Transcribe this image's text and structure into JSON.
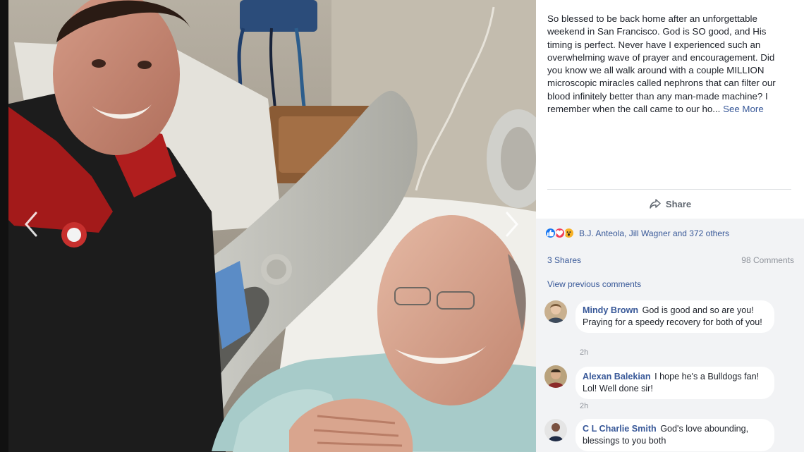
{
  "post": {
    "caption": "So blessed to be back home after an unforgettable weekend in San Francisco. God is SO good, and His timing is perfect. Never have I experienced such an overwhelming wave of prayer and encouragement. Did you know we all walk around with a couple MILLION microscopic miracles called nephrons that can filter our blood infinitely better than any man-made machine? I remember when the call came to our ho...",
    "see_more_label": "See More",
    "share_label": "Share"
  },
  "reactions": {
    "icons": [
      "like-icon",
      "love-icon",
      "wow-icon"
    ],
    "text": "B.J. Anteola, Jill Wagner and 372 others",
    "colors": {
      "like": "#1877f2",
      "love": "#f33e58",
      "wow": "#f7b125"
    }
  },
  "stats": {
    "shares": "3 Shares",
    "comments": "98 Comments",
    "view_previous": "View previous comments"
  },
  "comments": [
    {
      "author": "Mindy Brown",
      "text": "God is good and so are you! Praying for a speedy recovery for both of you!",
      "time": "2h"
    },
    {
      "author": "Alexan Balekian",
      "text": "I hope he's a Bulldogs fan! Lol! Well done sir!",
      "time": "2h"
    },
    {
      "author": "C L Charlie Smith",
      "text": "God's love abounding, blessings to you both",
      "time": ""
    }
  ],
  "theme": {
    "link": "#385898",
    "text": "#1d2129",
    "muted": "#90949c",
    "panel_bg": "#f2f3f5"
  }
}
